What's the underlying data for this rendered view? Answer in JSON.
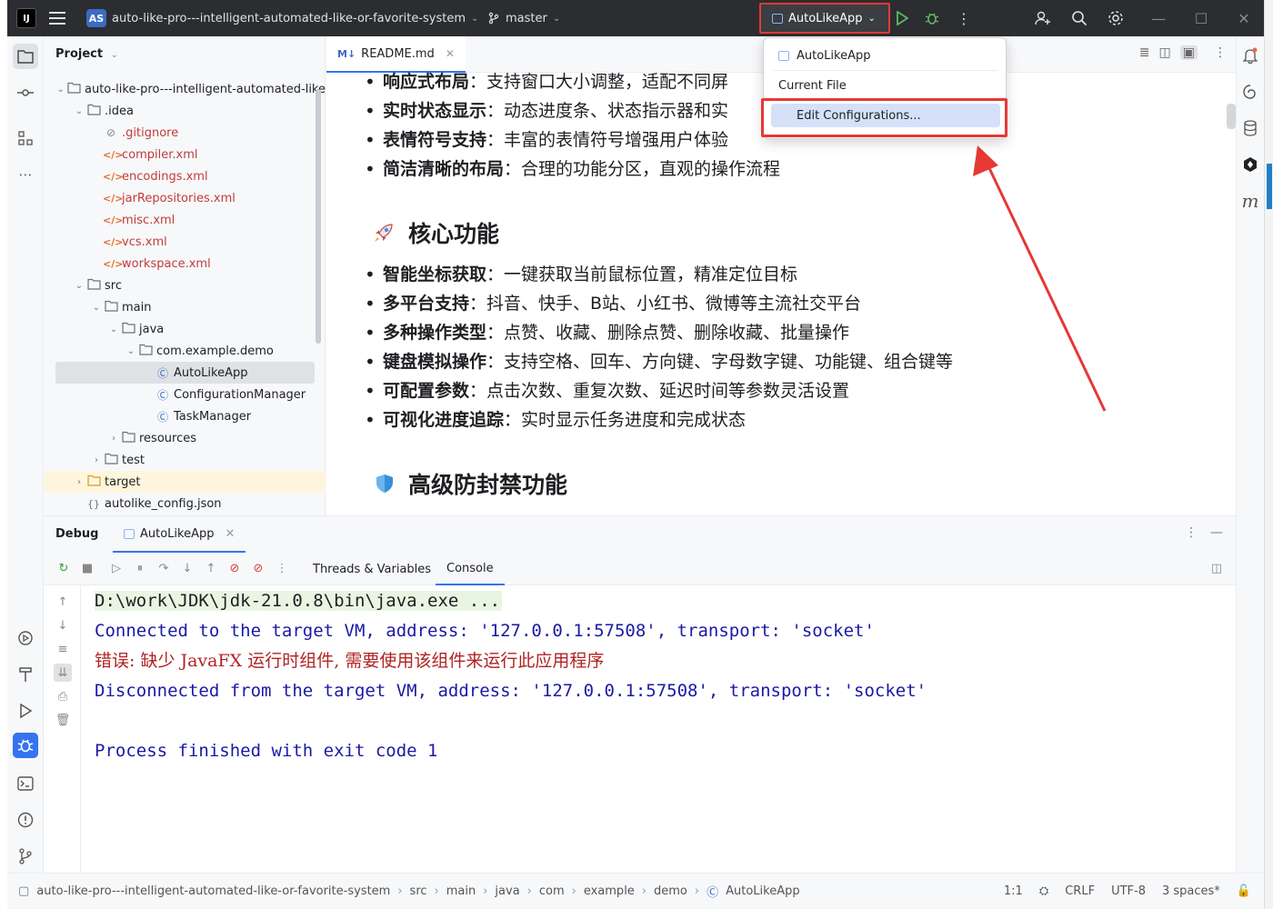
{
  "titlebar": {
    "project_badge": "AS",
    "project_name": "auto-like-pro---intelligent-automated-like-or-favorite-system",
    "branch": "master",
    "run_config": "AutoLikeApp"
  },
  "project_panel": {
    "title": "Project",
    "tree": [
      {
        "label": "auto-like-pro---intelligent-automated-like",
        "kind": "folder",
        "depth": 0,
        "expanded": true
      },
      {
        "label": ".idea",
        "kind": "folder",
        "depth": 1,
        "expanded": true
      },
      {
        "label": ".gitignore",
        "kind": "gitignore",
        "depth": 2
      },
      {
        "label": "compiler.xml",
        "kind": "xml",
        "depth": 2
      },
      {
        "label": "encodings.xml",
        "kind": "xml",
        "depth": 2
      },
      {
        "label": "jarRepositories.xml",
        "kind": "xml",
        "depth": 2
      },
      {
        "label": "misc.xml",
        "kind": "xml",
        "depth": 2
      },
      {
        "label": "vcs.xml",
        "kind": "xml",
        "depth": 2
      },
      {
        "label": "workspace.xml",
        "kind": "xml",
        "depth": 2
      },
      {
        "label": "src",
        "kind": "folder",
        "depth": 1,
        "expanded": true
      },
      {
        "label": "main",
        "kind": "folder",
        "depth": 2,
        "expanded": true
      },
      {
        "label": "java",
        "kind": "folder",
        "depth": 3,
        "expanded": true
      },
      {
        "label": "com.example.demo",
        "kind": "package",
        "depth": 4,
        "expanded": true
      },
      {
        "label": "AutoLikeApp",
        "kind": "class",
        "depth": 5,
        "selected": true
      },
      {
        "label": "ConfigurationManager",
        "kind": "class",
        "depth": 5
      },
      {
        "label": "TaskManager",
        "kind": "class",
        "depth": 5
      },
      {
        "label": "resources",
        "kind": "folder",
        "depth": 3,
        "expanded": false
      },
      {
        "label": "test",
        "kind": "folder",
        "depth": 2,
        "expanded": false
      },
      {
        "label": "target",
        "kind": "folder",
        "depth": 1,
        "expanded": false,
        "highlight": true
      },
      {
        "label": "autolike_config.json",
        "kind": "json",
        "depth": 1
      }
    ]
  },
  "editor": {
    "tab_label": "README.md",
    "bullets_top": [
      {
        "bold": "响应式布局",
        "rest": "：支持窗口大小调整，适配不同屏"
      },
      {
        "bold": "实时状态显示",
        "rest": "：动态进度条、状态指示器和实"
      },
      {
        "bold": "表情符号支持",
        "rest": "：丰富的表情符号增强用户体验"
      },
      {
        "bold": "简洁清晰的布局",
        "rest": "：合理的功能分区，直观的操作流程"
      }
    ],
    "heading_core": "核心功能",
    "bullets_core": [
      {
        "bold": "智能坐标获取",
        "rest": "：一键获取当前鼠标位置，精准定位目标"
      },
      {
        "bold": "多平台支持",
        "rest": "：抖音、快手、B站、小红书、微博等主流社交平台"
      },
      {
        "bold": "多种操作类型",
        "rest": "：点赞、收藏、删除点赞、删除收藏、批量操作"
      },
      {
        "bold": "键盘模拟操作",
        "rest": "：支持空格、回车、方向键、字母数字键、功能键、组合键等"
      },
      {
        "bold": "可配置参数",
        "rest": "：点击次数、重复次数、延迟时间等参数灵活设置"
      },
      {
        "bold": "可视化进度追踪",
        "rest": "：实时显示任务进度和完成状态"
      }
    ],
    "heading_anti": "高级防封禁功能"
  },
  "dropdown": {
    "items": [
      "AutoLikeApp",
      "Current File",
      "Edit Configurations..."
    ]
  },
  "debug": {
    "title": "Debug",
    "session_tab": "AutoLikeApp",
    "tabs": [
      "Threads & Variables",
      "Console"
    ],
    "console": [
      "D:\\work\\JDK\\jdk-21.0.8\\bin\\java.exe ...",
      "Connected to the target VM, address: '127.0.0.1:57508', transport: 'socket'",
      "错误: 缺少 JavaFX 运行时组件, 需要使用该组件来运行此应用程序",
      "Disconnected from the target VM, address: '127.0.0.1:57508', transport: 'socket'",
      "Process finished with exit code 1"
    ]
  },
  "statusbar": {
    "breadcrumbs": [
      "auto-like-pro---intelligent-automated-like-or-favorite-system",
      "src",
      "main",
      "java",
      "com",
      "example",
      "demo",
      "AutoLikeApp"
    ],
    "position": "1:1",
    "line_sep": "CRLF",
    "encoding": "UTF-8",
    "indent": "3 spaces*"
  },
  "colors": {
    "accent": "#3574f0",
    "annotation_red": "#e53935",
    "console_blue": "#1a1aa6",
    "console_red": "#b22222"
  }
}
